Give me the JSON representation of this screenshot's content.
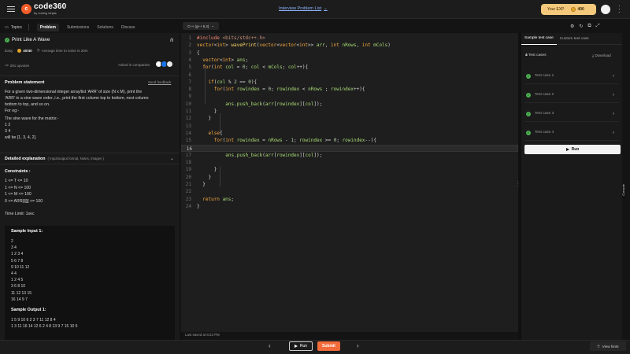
{
  "header": {
    "brand": "code360",
    "brand_sub": "by coding ninjas",
    "center_link": "Interview Problem List",
    "exp_label": "Your EXP",
    "exp_value": "400"
  },
  "left_tabs": [
    "Topics",
    "Problem",
    "Submissions",
    "Solutions",
    "Discuss"
  ],
  "problem": {
    "title": "Print Like A Wave",
    "difficulty": "Easy",
    "score": "40/40",
    "avg_time": "Average time to solve is 20m",
    "upvotes": "281 upvotes",
    "asked_in": "Asked in companies",
    "statement_heading": "Problem statement",
    "feedback": "Send feedback",
    "statement_lines": [
      "For a given two-dimensional integer array/list 'ARR' of size (N x M), print the",
      "'ARR' in a sine wave order, i.e., print the first column top to bottom, next column",
      "bottom to top, and so on.",
      "For eg:-",
      "",
      "The sine wave for the matrix:-",
      "1 2",
      "3 4",
      "will be [1, 3, 4, 2]."
    ],
    "detailed_heading": "Detailed explanation",
    "detailed_sub": "( Input/output format, Notes, Images )",
    "constraints_heading": "Constraints :",
    "constraints": [
      "1 <= T <= 10",
      "1 <= N <= 100",
      "1 <= M <= 100",
      "0 <= ARR[i][j] <= 100"
    ],
    "time_limit": "Time Limit: 1sec",
    "sample_input_heading": "Sample Input 1:",
    "sample_input": [
      "2",
      "3 4",
      "1 2 3 4",
      "5 6 7 8",
      "9 10 11 12",
      "4 4",
      "1 2 4 5",
      "3 6 8 10",
      "11 12 13 15",
      "16 14 9 7"
    ],
    "sample_output_heading": "Sample Output 1:",
    "sample_output": [
      "1 5 9 10 6 2 3 7 11 12 8 4",
      "1 3 11 16 14 12 6 2 4 8 13 9 7 15 10 5"
    ]
  },
  "editor": {
    "language": "C++ (g++ 5.4)",
    "last_saved": "Last saved at 8:22 PM",
    "lines": [
      "#include <bits/stdc++.h>",
      "vector<int> wavePrint(vector<vector<int>> arr, int nRows, int mCols)",
      "{",
      "  vector<int> ans;",
      "  for(int col = 0; col < mCols; col++){",
      "",
      "    if(col % 2 == 0){",
      "      for(int rowindex = 0; rowindex < nRows ; rowindex++){",
      "",
      "          ans.push_back(arr[rowindex][col]);",
      "      }",
      "    }",
      "",
      "    else{",
      "      for(int rowindex = nRows - 1; rowindex >= 0; rowindex--){",
      "",
      "          ans.push_back(arr[rowindex][col]);",
      "",
      "      }",
      "    }",
      "  }",
      "",
      "  return ans;",
      "}"
    ]
  },
  "right": {
    "tab_sample": "Sample test case",
    "tab_custom": "Custom test case",
    "test_count_num": "4",
    "test_count_label": "Test cases",
    "download": "Download",
    "cases": [
      "Test case 1",
      "Test case 2",
      "Test case 3",
      "Test case 4"
    ],
    "run": "Run",
    "console": "Console"
  },
  "bottom": {
    "run": "Run",
    "submit": "Submit",
    "hints": "View hints"
  },
  "colors": {
    "accent": "#f26b3a",
    "success": "#4caf50",
    "exp_badge": "#f5c97b"
  }
}
